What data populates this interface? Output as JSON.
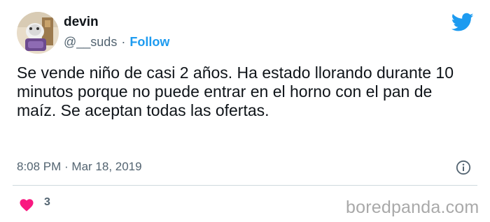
{
  "tweet": {
    "author": {
      "display_name": "devin",
      "handle": "@__suds",
      "follow_label": "Follow"
    },
    "text": "Se vende niño de casi 2 años. Ha estado llorando durante 10 minutos porque no puede entrar en el horno con el pan de maíz. Se aceptan todas las ofertas.",
    "timestamp": "8:08 PM · Mar 18, 2019",
    "like_count": "3"
  },
  "icons": {
    "brand": "twitter-bird-icon",
    "info": "info-icon",
    "like": "heart-icon"
  },
  "watermark": "boredpanda.com",
  "colors": {
    "accent": "#1d9bf0",
    "heart": "#f91880",
    "secondary_text": "#536471",
    "primary_text": "#0f1419"
  }
}
